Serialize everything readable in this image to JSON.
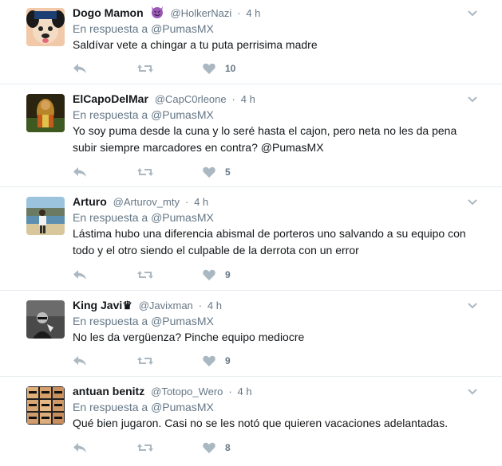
{
  "reply_prefix": "En respuesta a",
  "reply_target": "@PumasMX",
  "tweets": [
    {
      "name": "Dogo Mamon",
      "handle": "@HolkerNazi",
      "time": "4 h",
      "has_badge": true,
      "badge_icon": "devil-emoji-icon",
      "text": "Saldívar vete a chingar a tu puta perrisima madre",
      "likes": "10"
    },
    {
      "name": "ElCapoDelMar",
      "handle": "@CapC0rleone",
      "time": "4 h",
      "has_badge": false,
      "text_lines": [
        "Yo soy puma desde la cuna y lo seré hasta el cajon, pero neta no les da pena",
        "subir siempre marcadores en contra?  @PumasMX"
      ],
      "likes": "5"
    },
    {
      "name": "Arturo",
      "handle": "@Arturov_mty",
      "time": "4 h",
      "has_badge": false,
      "text_lines": [
        "Lástima hubo una diferencia abismal de porteros uno salvando a su equipo con",
        "todo y el otro siendo el culpable de la derrota con un error"
      ],
      "likes": "9"
    },
    {
      "name": "King Javi♛",
      "handle": "@Javixman",
      "time": "4 h",
      "has_badge": false,
      "text": "No les da vergüenza? Pinche equipo mediocre",
      "likes": "9"
    },
    {
      "name": "antuan benitz",
      "handle": "@Totopo_Wero",
      "time": "4 h",
      "has_badge": false,
      "text": "Qué bien jugaron. Casi no se les notó que quieren vacaciones adelantadas.",
      "likes": "8"
    }
  ],
  "colors": {
    "meta": "#657786",
    "text": "#14171a",
    "icon": "#aab8c2",
    "divider": "#e6ecf0"
  }
}
